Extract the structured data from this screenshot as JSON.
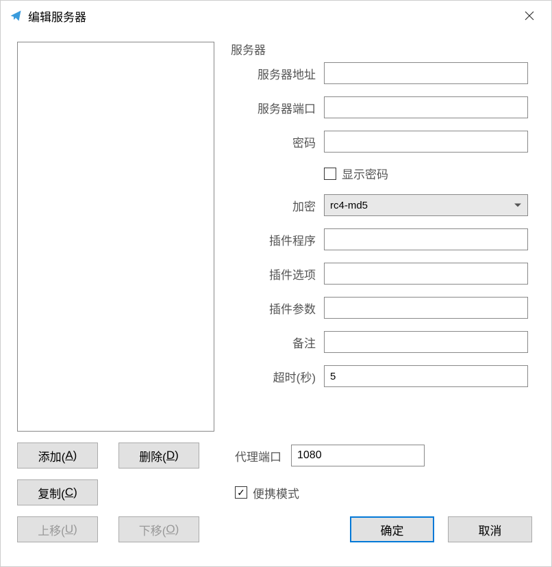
{
  "window": {
    "title": "编辑服务器"
  },
  "server": {
    "legend": "服务器",
    "fields": {
      "address_label": "服务器地址",
      "address_value": "",
      "port_label": "服务器端口",
      "port_value": "",
      "password_label": "密码",
      "password_value": "",
      "show_password_label": "显示密码",
      "show_password_checked": false,
      "encryption_label": "加密",
      "encryption_value": "rc4-md5",
      "plugin_program_label": "插件程序",
      "plugin_program_value": "",
      "plugin_options_label": "插件选项",
      "plugin_options_value": "",
      "plugin_args_label": "插件参数",
      "plugin_args_value": "",
      "remark_label": "备注",
      "remark_value": "",
      "timeout_label": "超时(秒)",
      "timeout_value": "5"
    }
  },
  "buttons": {
    "add": "添加(",
    "add_key": "A",
    "add_suffix": ")",
    "delete": "删除(",
    "delete_key": "D",
    "delete_suffix": ")",
    "copy": "复制(",
    "copy_key": "C",
    "copy_suffix": ")",
    "moveup": "上移(",
    "moveup_key": "U",
    "moveup_suffix": ")",
    "movedown": "下移(",
    "movedown_key": "O",
    "movedown_suffix": ")",
    "ok": "确定",
    "cancel": "取消"
  },
  "proxy": {
    "label": "代理端口",
    "value": "1080"
  },
  "portable": {
    "label": "便携模式",
    "checked": true
  }
}
